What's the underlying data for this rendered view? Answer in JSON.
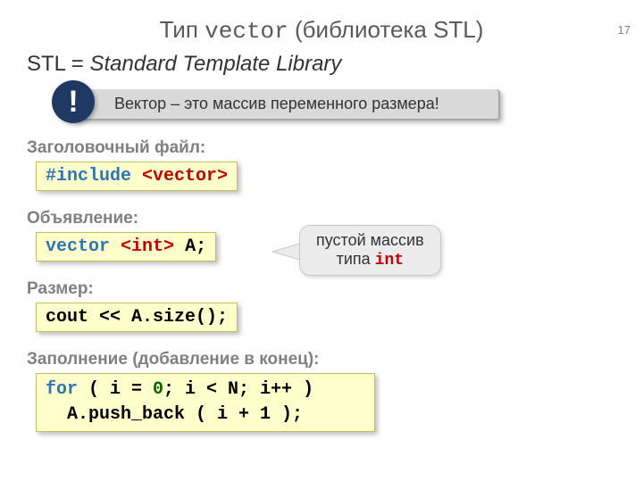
{
  "page_number": "17",
  "title_plain_1": "Тип ",
  "title_mono": "vector",
  "title_plain_2": " (библиотека STL)",
  "subtitle_abbr": "STL",
  "subtitle_eq": " = ",
  "subtitle_expansion": "Standard Template Library",
  "callout_bang": "!",
  "callout_text": "Вектор – это массив переменного размера!",
  "section1": "Заголовочный файл:",
  "code1_kw": "#include",
  "code1_rest": " <vector>",
  "section2": "Объявление:",
  "code2_kw": "vector",
  "code2_type_open": " <",
  "code2_type": "int",
  "code2_type_close": ">",
  "code2_rest": " A;",
  "bubble_line1": "пустой массив",
  "bubble_line2_a": "типа ",
  "bubble_line2_b": "int",
  "section3": "Размер:",
  "code3_a": "cout ",
  "code3_b": "<< A.size();",
  "section4": "Заполнение (добавление в конец):",
  "code4_kw": "for",
  "code4_a": " ( i = ",
  "code4_zero": "0",
  "code4_b": "; i < N; i++ )",
  "code4_line2": "  A.push_back ( i + 1 );"
}
